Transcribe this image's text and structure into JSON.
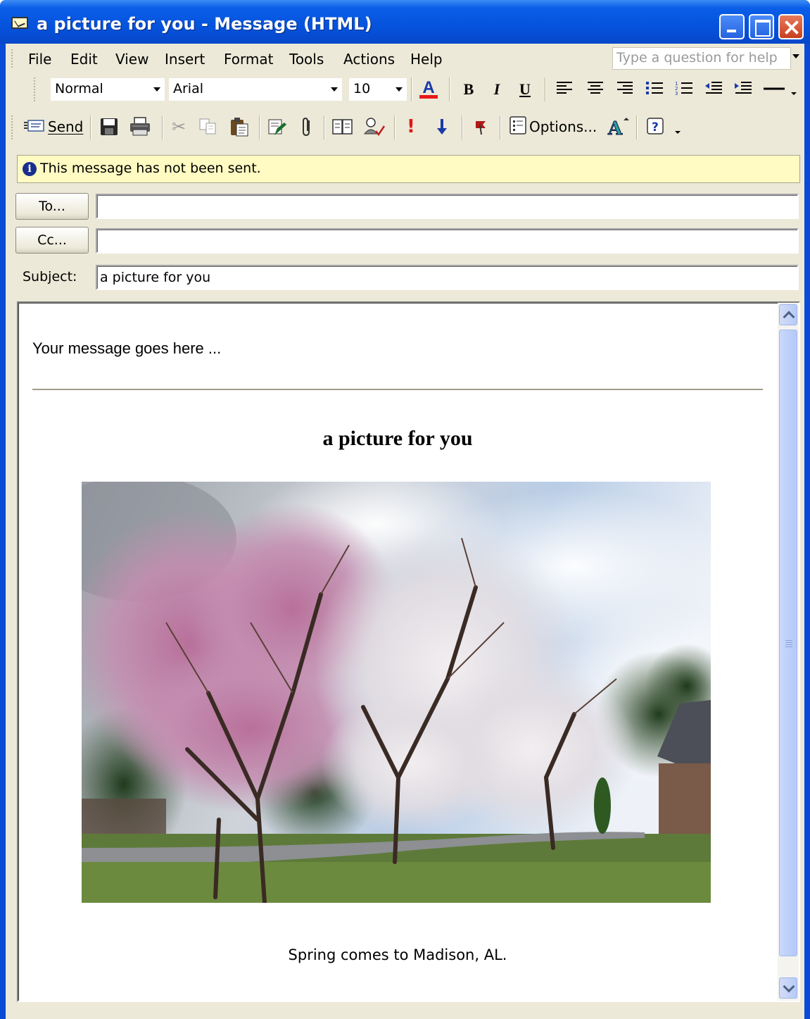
{
  "window": {
    "title": "a picture for you - Message (HTML)"
  },
  "menu": {
    "items": [
      "File",
      "Edit",
      "View",
      "Insert",
      "Format",
      "Tools",
      "Actions",
      "Help"
    ],
    "help_placeholder": "Type a question for help"
  },
  "format_toolbar": {
    "style": "Normal",
    "font": "Arial",
    "size": "10",
    "bold": "B",
    "italic": "I",
    "underline": "U"
  },
  "standard_toolbar": {
    "send_label": "Send",
    "options_label": "Options..."
  },
  "infobar": {
    "text": "This message has not been sent."
  },
  "fields": {
    "to_label": "To...",
    "to_value": "",
    "cc_label": "Cc...",
    "cc_value": "",
    "subject_label": "Subject:",
    "subject_value": "a picture for you"
  },
  "message": {
    "intro": "Your message goes here ...",
    "picture_title": "a picture for you",
    "caption": "Spring comes to Madison, AL."
  },
  "colors": {
    "titlebar": "#0553dd",
    "infobar_bg": "#fffbc2",
    "chrome": "#ece9d8"
  }
}
